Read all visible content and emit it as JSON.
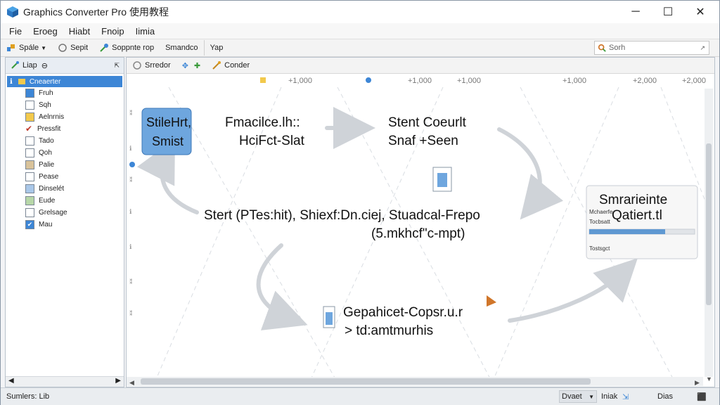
{
  "window": {
    "title": "Graphics Converter Pro 使用教程"
  },
  "controls": {
    "minimize": "─",
    "maximize": "☐",
    "close": "✕"
  },
  "menu": [
    "Fie",
    "Eroeg",
    "Hiabt",
    "Fnoip",
    "Iimia"
  ],
  "toolbar1": {
    "items": [
      "Spále",
      "Sepit",
      "Soppnte rop",
      "Smandco",
      "Yap"
    ],
    "search_text": "Sorh"
  },
  "sidebar": {
    "tab_label": "Liap",
    "root_label": "Cneaerter",
    "items": [
      "Fruh",
      "Sqh",
      "Aelnrnis",
      "Pressfit",
      "Tado",
      "Qoh",
      "Palie",
      "Pease",
      "Dinselét",
      "Eude",
      "Grelsage",
      "Mau"
    ]
  },
  "canvas_toolbar": {
    "items": [
      "Srredor",
      "Conder"
    ]
  },
  "ruler": {
    "marks": [
      "+1,000",
      "+1,000",
      "+1,000",
      "+1,000",
      "+2,000",
      "+2,000"
    ]
  },
  "diagram": {
    "box1": {
      "line1": "StileHrt,",
      "line2": "Smist"
    },
    "text_a": {
      "line1": "Fmacilce.lh::",
      "line2": "HciFct-Slat"
    },
    "text_b": {
      "line1": "Stent Coeurlt",
      "line2": "Snaf +Seen"
    },
    "center": {
      "line1": "Stert (PTes:hit), Shiexf:Dn.ciej, Stuadcal-Frepo",
      "line2": "(5.mkhcf\"c-mpt)"
    },
    "right_box": {
      "title1": "Smrarieinte",
      "title2": "Qatiert.tl",
      "label1": "Mchaerfe",
      "label2": "Tocbsatt",
      "label3": "Tostsgct",
      "progress": 0.72
    },
    "bottom": {
      "line1": "Gepahicet-Copsr.u.r",
      "line2": "> td:amtmurhis"
    }
  },
  "status": {
    "left": "Sumlers: Lib",
    "btn1": "Dvaet",
    "btn2": "Iniak",
    "btn3": "Dias"
  },
  "colors": {
    "accent": "#3d86d6",
    "box1_fill": "#6ea6de",
    "progress_fill": "#5f98d2"
  }
}
